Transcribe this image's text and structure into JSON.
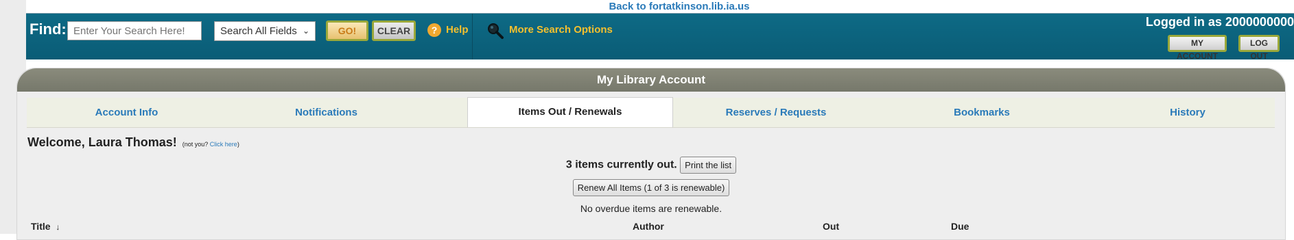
{
  "back_link": "Back to fortatkinson.lib.ia.us",
  "search": {
    "find_label": "Find:",
    "placeholder": "Enter Your Search Here!",
    "field_select": "Search All Fields",
    "go_label": "GO!",
    "clear_label": "CLEAR",
    "help_label": "Help",
    "more_options_label": "More Search Options"
  },
  "account_bar": {
    "logged_in_text": "Logged in as 2000000000",
    "my_account_label": "MY ACCOUNT",
    "logout_label": "LOG OUT"
  },
  "panel": {
    "title": "My Library Account",
    "tabs": [
      {
        "label": "Account Info"
      },
      {
        "label": "Notifications"
      },
      {
        "label": "Items Out / Renewals",
        "active": true
      },
      {
        "label": "Reserves / Requests"
      },
      {
        "label": "Bookmarks"
      },
      {
        "label": "History"
      }
    ],
    "welcome": "Welcome, Laura Thomas!",
    "not_you_prefix": "(not you?",
    "click_here": "Click here",
    "not_you_suffix": ")",
    "items_count_text": "3 items currently out.",
    "print_label": "Print the list",
    "renew_label": "Renew All Items (1 of 3 is renewable)",
    "no_overdue_text": "No overdue items are renewable.",
    "columns": {
      "title": "Title",
      "sort_arrow": "↓",
      "author": "Author",
      "out": "Out",
      "due": "Due"
    }
  },
  "colors": {
    "topbar": "#0e6a85",
    "link": "#2a7ab9",
    "accent_yellow": "#f5c02d",
    "panel_header": "#8a8b7c"
  }
}
